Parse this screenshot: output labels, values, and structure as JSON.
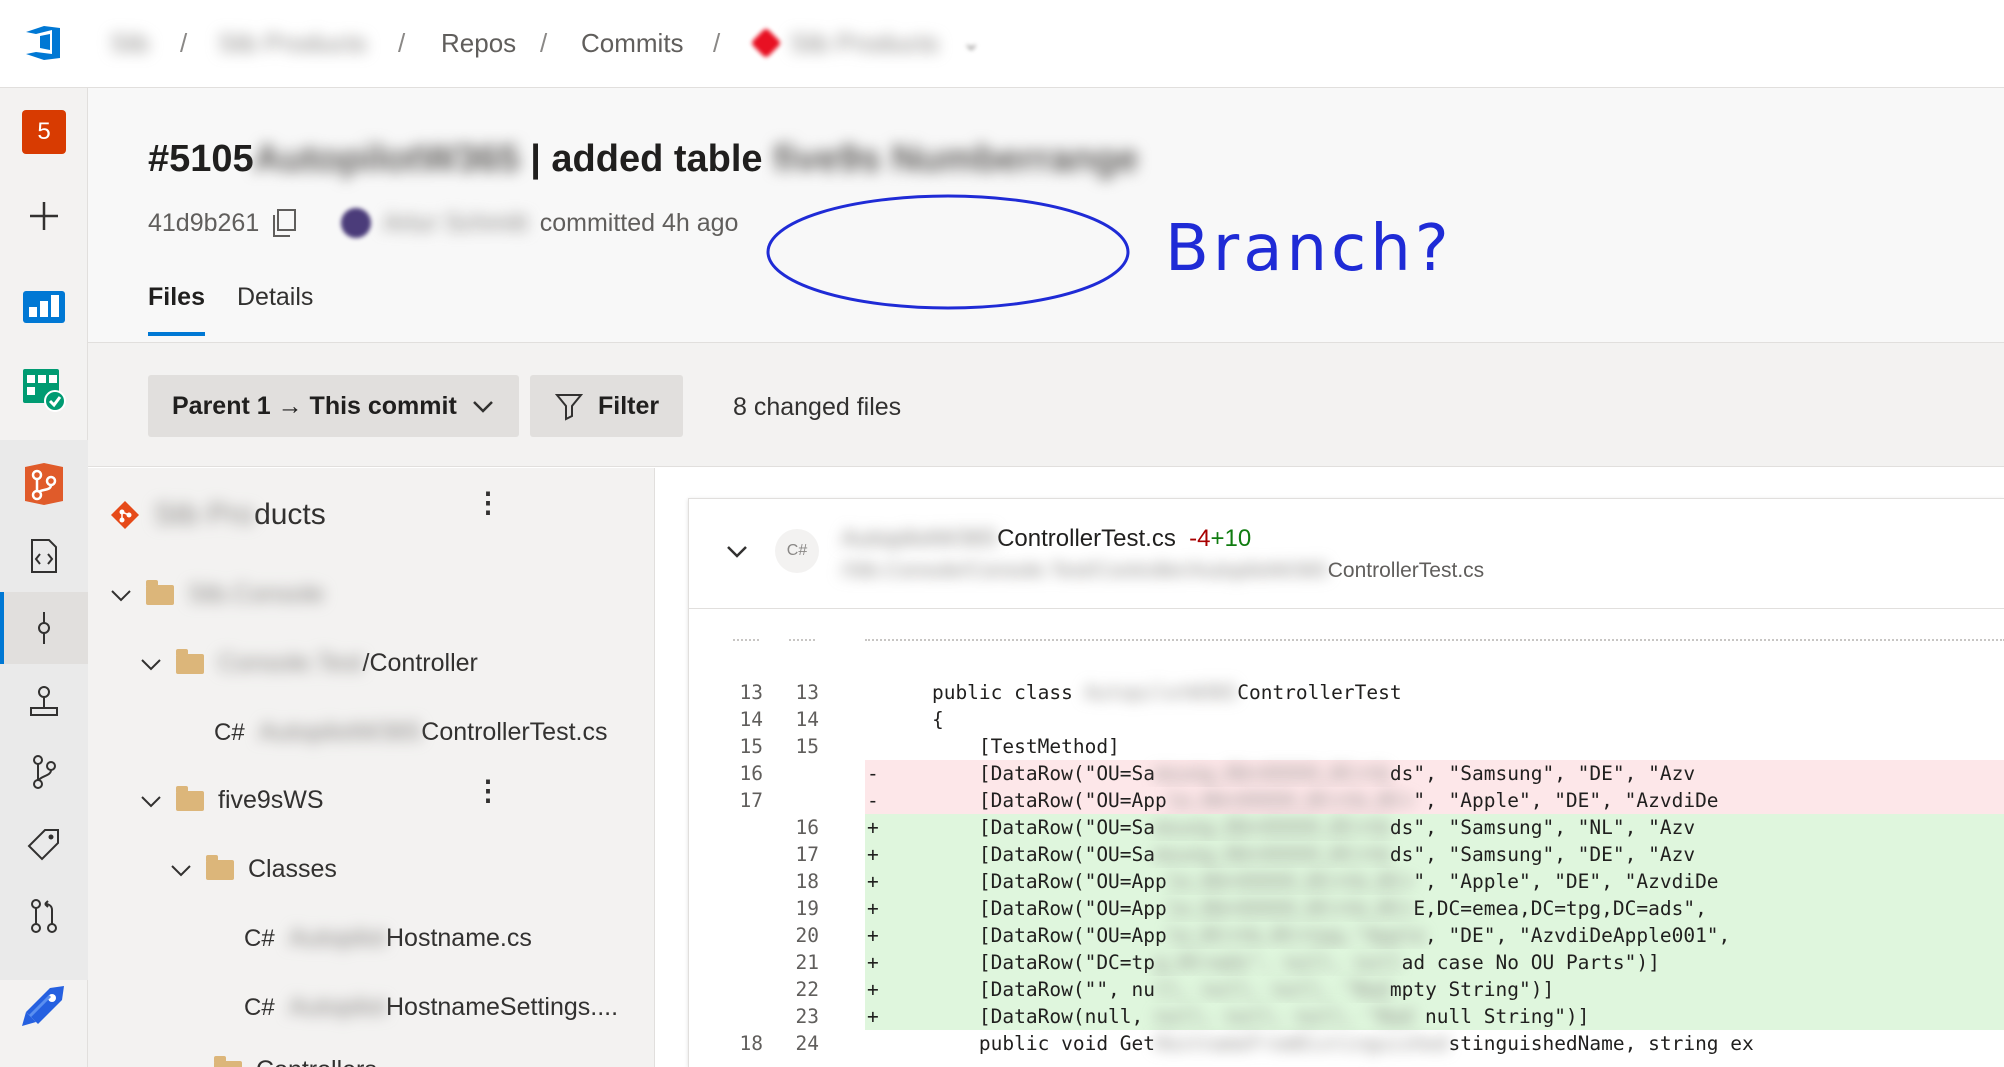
{
  "breadcrumb": {
    "org": "Stb",
    "project": "Stb Products",
    "repos": "Repos",
    "commits": "Commits",
    "repo": "Stb Products"
  },
  "rail": {
    "notification_count": "5"
  },
  "commit": {
    "title_prefix": "#5105",
    "title_blur": "AutopilotW365",
    "title_main": "| added table",
    "title_blur2": "five9s Numberrange",
    "hash": "41d9b261",
    "author": "Artur Schmitt",
    "action": "committed 4h ago"
  },
  "annotation": {
    "text": "Branch?"
  },
  "tabs": [
    "Files",
    "Details"
  ],
  "toolbar": {
    "compare_label": "Parent 1 → This commit",
    "filter_label": "Filter",
    "changed_files": "8 changed files"
  },
  "tree": {
    "repo_blur": "Stb Pro",
    "repo_suffix": "ducts",
    "items": [
      {
        "blur": "Stb.Console",
        "label": ""
      },
      {
        "blur": "Console.Test",
        "label": "/Controller"
      },
      {
        "lang": "C#",
        "blur": "AutopilotW365",
        "label": "ControllerTest.cs"
      },
      {
        "blur": "",
        "label": "five9sWS"
      },
      {
        "blur": "",
        "label": "Classes"
      },
      {
        "lang": "C#",
        "blur": "Autopilot",
        "label": "Hostname.cs"
      },
      {
        "lang": "C#",
        "blur": "Autopilot",
        "label": "HostnameSettings...."
      },
      {
        "blur": "",
        "label": "Controllers"
      }
    ]
  },
  "file": {
    "lang": "C#",
    "name_blur": "AutopilotW365",
    "name": "ControllerTest.cs",
    "deleted": "-4",
    "added": "+10",
    "path_blur": "/Stb.Console/Console.Test/Controller/AutopilotW365",
    "path": "ControllerTest.cs"
  },
  "code_lines": [
    {
      "old": "13",
      "new": "13",
      "type": "ctx",
      "mark": "",
      "text": "    public class ",
      "blur": "AutopilotW365",
      "rest": "ControllerTest"
    },
    {
      "old": "14",
      "new": "14",
      "type": "ctx",
      "mark": "",
      "text": "    {",
      "blur": "",
      "rest": ""
    },
    {
      "old": "15",
      "new": "15",
      "type": "ctx",
      "mark": "",
      "text": "        [TestMethod]",
      "blur": "",
      "rest": ""
    },
    {
      "old": "16",
      "new": "",
      "type": "del",
      "mark": "-",
      "text": "        [DataRow(\"OU=Sa",
      "blur": "msung,OU=XXXXX,DC=tb",
      "rest": "ds\", \"Samsung\", \"DE\", \"Azv"
    },
    {
      "old": "17",
      "new": "",
      "type": "del",
      "mark": "-",
      "text": "        [DataRow(\"OU=App",
      "blur": "le,OU=XXXXX,DC=tb,DC=",
      "rest": "\", \"Apple\", \"DE\", \"AzvdiDe"
    },
    {
      "old": "",
      "new": "16",
      "type": "add",
      "mark": "+",
      "text": "        [DataRow(\"OU=Sa",
      "blur": "msung,OU=XXXXX,DC=tb",
      "rest": "ds\", \"Samsung\", \"NL\", \"Azv"
    },
    {
      "old": "",
      "new": "17",
      "type": "add",
      "mark": "+",
      "text": "        [DataRow(\"OU=Sa",
      "blur": "msung,OU=XXXXX,DC=tb",
      "rest": "ds\", \"Samsung\", \"DE\", \"Azv"
    },
    {
      "old": "",
      "new": "18",
      "type": "add",
      "mark": "+",
      "text": "        [DataRow(\"OU=App",
      "blur": "le,OU=XXXXX,DC=tb,DC=",
      "rest": "\", \"Apple\", \"DE\", \"AzvdiDe"
    },
    {
      "old": "",
      "new": "19",
      "type": "add",
      "mark": "+",
      "text": "        [DataRow(\"OU=App",
      "blur": "le,OU=XXXXX,DC=tb,DC=",
      "rest": "E,DC=emea,DC=tpg,DC=ads\","
    },
    {
      "old": "",
      "new": "20",
      "type": "add",
      "mark": "+",
      "text": "        [DataRow(\"OU=App",
      "blur": "le,DC=tb,DC=tpg,\"Apple",
      "rest": ", \"DE\", \"AzvdiDeApple001\","
    },
    {
      "old": "",
      "new": "21",
      "type": "add",
      "mark": "+",
      "text": "        [DataRow(\"DC=tp",
      "blur": "g,DC=ads\", null, null",
      "rest": "ad case No OU Parts\")]"
    },
    {
      "old": "",
      "new": "22",
      "type": "add",
      "mark": "+",
      "text": "        [DataRow(\"\", nu",
      "blur": "ll, null, null, \"Bad",
      "rest": "mpty String\")]"
    },
    {
      "old": "",
      "new": "23",
      "type": "add",
      "mark": "+",
      "text": "        [DataRow(null, ",
      "blur": "null, null, null, \"Bad",
      "rest": " null String\")]"
    },
    {
      "old": "18",
      "new": "24",
      "type": "ctx",
      "mark": "",
      "text": "        public void Get",
      "blur": "HostnameFromDistinguished",
      "rest": "stinguishedName, string ex"
    }
  ],
  "colors": {
    "accent": "#0078d4",
    "deleted_bg": "#fde7e9",
    "added_bg": "#dff6dd",
    "annotation": "#1f2bd6"
  }
}
